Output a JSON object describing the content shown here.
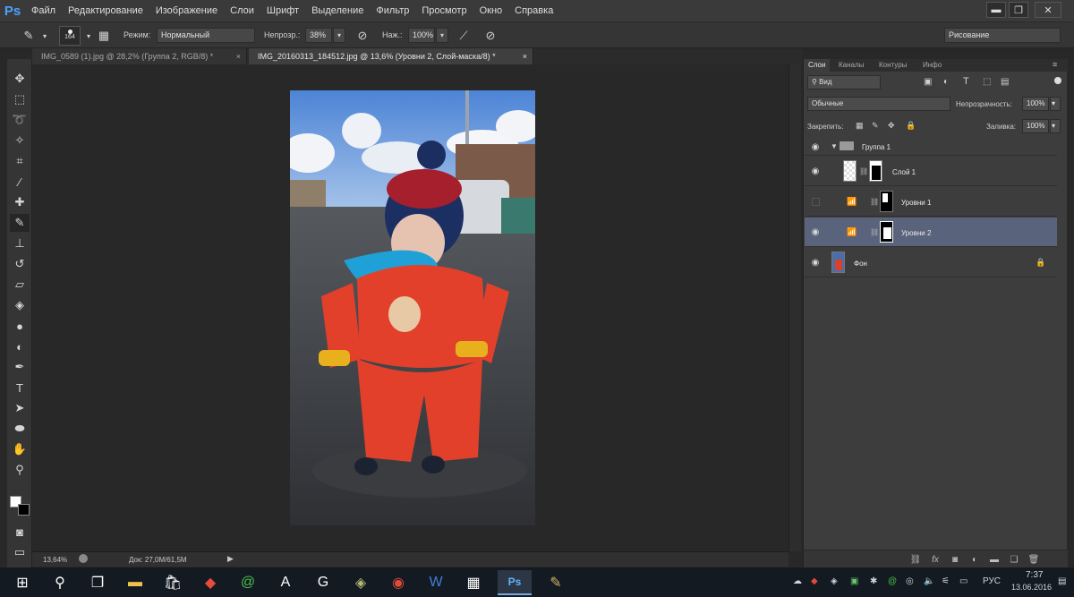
{
  "app": {
    "logo": "Ps"
  },
  "menu": [
    "Файл",
    "Редактирование",
    "Изображение",
    "Слои",
    "Шрифт",
    "Выделение",
    "Фильтр",
    "Просмотр",
    "Окно",
    "Справка"
  ],
  "window_controls": {
    "minimize": "▬",
    "restore": "❐",
    "close": "✕"
  },
  "options": {
    "brush_size": "164",
    "mode_label": "Режим:",
    "mode_value": "Нормальный",
    "opacity_label": "Непрозр.:",
    "opacity_value": "38%",
    "flow_label": "Наж.:",
    "flow_value": "100%",
    "workspace": "Рисование"
  },
  "tabs": [
    {
      "label": "IMG_0589 (1).jpg @ 28,2% (Группа 2, RGB/8) *",
      "close": "×"
    },
    {
      "label": "IMG_20160313_184512.jpg @ 13,6% (Уровни 2, Слой-маска/8) *",
      "close": "×"
    }
  ],
  "status": {
    "zoom": "13,64%",
    "doc": "Док: 27,0M/61,5M"
  },
  "layers_panel": {
    "tabs": [
      "Слои",
      "Каналы",
      "Контуры",
      "Инфо"
    ],
    "filter": "Вид",
    "blend_mode": "Обычные",
    "opacity_label": "Непрозрачность:",
    "opacity_value": "100%",
    "lock_label": "Закрепить:",
    "fill_label": "Заливка:",
    "fill_value": "100%",
    "layers": [
      {
        "name": "Группа 1"
      },
      {
        "name": "Слой 1"
      },
      {
        "name": "Уровни 1"
      },
      {
        "name": "Уровни 2"
      },
      {
        "name": "Фон"
      }
    ]
  },
  "taskbar": {
    "language": "РУС",
    "time": "7:37",
    "date": "13.06.2016"
  }
}
